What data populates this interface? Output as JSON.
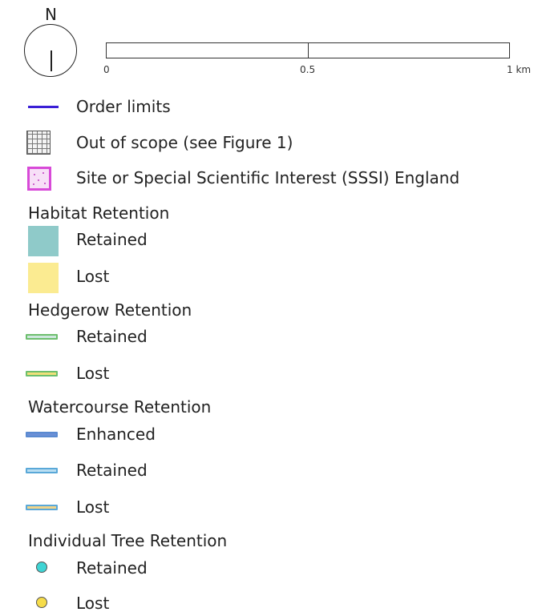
{
  "north_arrow": {
    "letter": "N"
  },
  "scale_bar": {
    "labels": [
      "0",
      "0.5",
      "1 km"
    ]
  },
  "legend": {
    "items": [
      {
        "label": "Order limits",
        "symbol": "line",
        "color": "#3a1fd6"
      },
      {
        "label": "Out of scope (see Figure 1)",
        "symbol": "grid-hatch",
        "color": "#777777"
      },
      {
        "label": "Site or Special Scientific Interest (SSSI) England",
        "symbol": "dotted-square",
        "color": "#d84ad8"
      }
    ],
    "sections": [
      {
        "title": "Habitat Retention",
        "items": [
          {
            "label": "Retained",
            "symbol": "square",
            "color": "#8fcac9"
          },
          {
            "label": "Lost",
            "symbol": "square",
            "color": "#fbeb91"
          }
        ]
      },
      {
        "title": "Hedgerow Retention",
        "items": [
          {
            "label": "Retained",
            "symbol": "line",
            "fill": "#cfe7df",
            "border": "#6dbf6d"
          },
          {
            "label": "Lost",
            "symbol": "line",
            "fill": "#f0e07a",
            "border": "#6dbf6d"
          }
        ]
      },
      {
        "title": "Watercourse Retention",
        "items": [
          {
            "label": "Enhanced",
            "symbol": "line",
            "fill": "#6b8fd6",
            "border": "#5a8ad0"
          },
          {
            "label": "Retained",
            "symbol": "line",
            "fill": "#b9def2",
            "border": "#5aa8d8"
          },
          {
            "label": "Lost",
            "symbol": "line",
            "fill": "#f0d48a",
            "border": "#5aa8d8"
          }
        ]
      },
      {
        "title": "Individual Tree Retention",
        "items": [
          {
            "label": "Retained",
            "symbol": "circle",
            "color": "#3fd4d4"
          },
          {
            "label": "Lost",
            "symbol": "circle",
            "color": "#f6dc4a"
          }
        ]
      }
    ]
  }
}
